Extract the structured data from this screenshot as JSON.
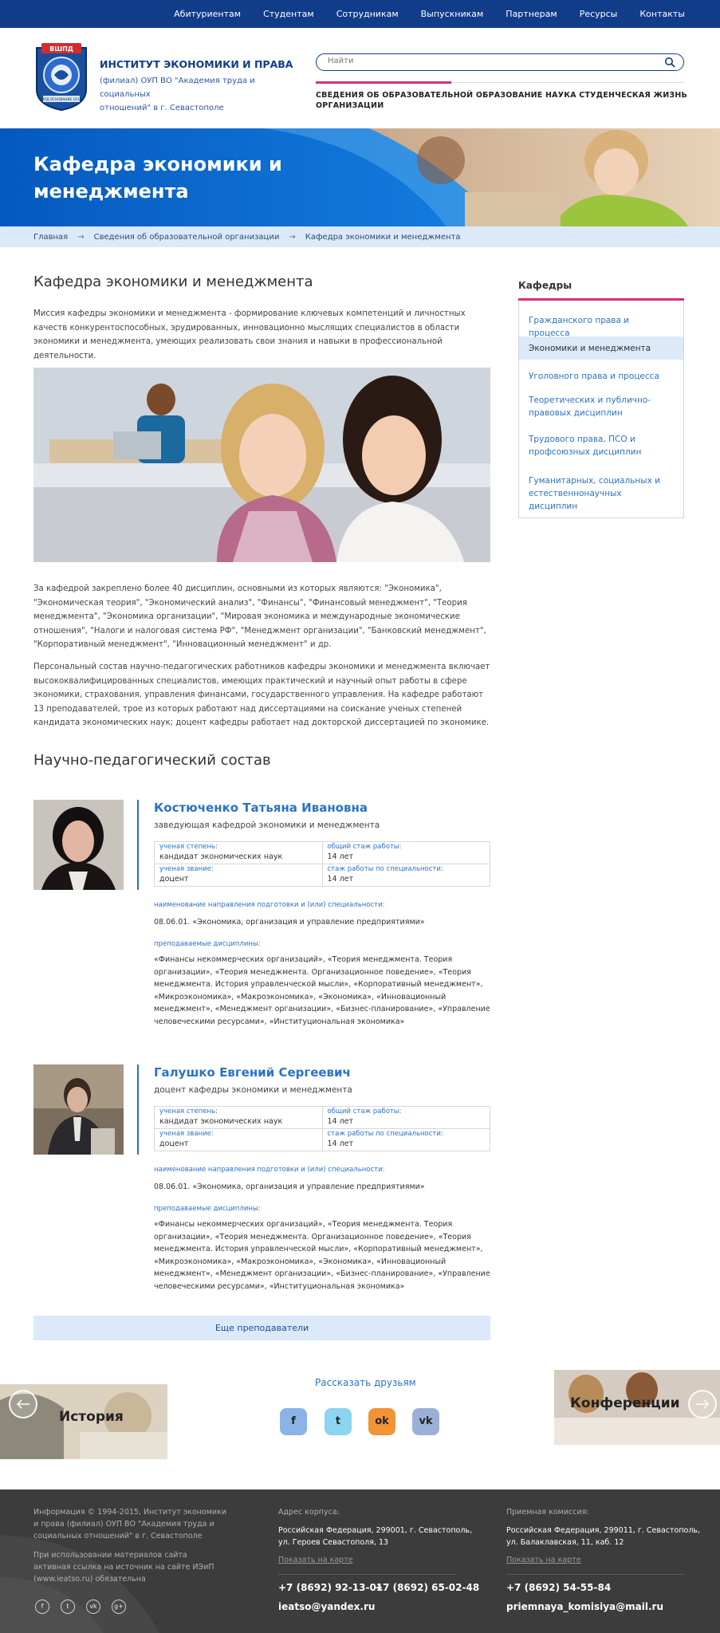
{
  "topnav": [
    "Абитуриентам",
    "Студентам",
    "Сотрудникам",
    "Выпускникам",
    "Партнерам",
    "Ресурсы",
    "Контакты"
  ],
  "header": {
    "title": "ИНСТИТУТ ЭКОНОМИКИ И ПРАВА",
    "subtitle1": "(филиал) ОУП ВО \"Академия труда и социальных",
    "subtitle2": "отношений\" в г. Севастополе",
    "logo_text1": "ВШПД",
    "logo_text2": "ПОД ОСНОВАНИЕ 1919"
  },
  "search": {
    "placeholder": "Найти"
  },
  "mainnav": [
    {
      "l1": "СВЕДЕНИЯ ОБ ОБРАЗОВАТЕЛЬНОЙ",
      "l2": "ОРГАНИЗАЦИИ"
    },
    {
      "l1": "ОБРАЗОВАНИЕ",
      "l2": ""
    },
    {
      "l1": "НАУКА",
      "l2": ""
    },
    {
      "l1": "СТУДЕНЧЕСКАЯ ЖИЗНЬ",
      "l2": ""
    }
  ],
  "hero": {
    "line1": "Кафедра экономики и",
    "line2": "менеджмента"
  },
  "breadcrumb": [
    "Главная",
    "Сведения об образовательной организации",
    "Кафедра экономики и менеджмента"
  ],
  "page": {
    "title": "Кафедра экономики и менеджмента",
    "mission": "Миссия кафедры экономики и менеджмента - формирование ключевых компетенций и личностных качеств конкурентоспособных, эрудированных, инновационно мыслящих специалистов в области экономики и менеджмента, умеющих реализовать свои знания и навыки в профессиональной деятельности.",
    "para2": "За кафедрой закреплено более 40 дисциплин, основными из которых являются: \"Экономика\", \"Экономическая теория\", \"Экономический анализ\", \"Финансы\", \"Финансовый менеджмент\", \"Теория менеджмента\", \"Экономика организации\", \"Мировая экономика и международные экономические отношения\", \"Налоги и налоговая система РФ\", \"Менеджмент организации\", \"Банковский менеджмент\", \"Корпоративный менеджмент\", \"Инновационный менеджмент\" и др.",
    "para3": "Персональный состав научно-педагогических работников кафедры экономики и менеджмента включает высококвалифицированных специалистов, имеющих практический и научный опыт работы в сфере экономики, страхования, управления финансами, государственного управления. На кафедре работают 13 преподавателей, трое из которых работают над диссертациями на соискание ученых степеней кандидата экономических наук; доцент кафедры работает над докторской диссертацией по экономике.",
    "staff_title": "Научно-педагогический состав"
  },
  "labels": {
    "degree": "ученая степень:",
    "total_exp": "общий стаж работы:",
    "rank": "ученая звание:",
    "spec_exp": "стаж работы по специальности:",
    "direction": "наименование направления подготовки и (или) специальности:",
    "disciplines": "преподаваемые дисциплины:"
  },
  "staff": [
    {
      "name": "Костюченко Татьяна Ивановна",
      "role": "заведующая кафедрой экономики и менеджмента",
      "degree": "кандидат экономических наук",
      "total_exp": "14 лет",
      "rank": "доцент",
      "spec_exp": "14 лет",
      "direction": "08.06.01. «Экономика, организация и управление предприятиями»",
      "disciplines": "«Финансы некоммерческих организаций», «Теория менеджмента. Теория организации», «Теория менеджмента. Организационное поведение», «Теория менеджмента. История управленческой мысли», «Корпоративный менеджмент», «Микроэкономика», «Макроэкономика», «Экономика», «Инновационный менеджмент», «Менеджмент организации», «Бизнес-планирование», «Управление человеческими ресурсами», «Институциональная экономика»"
    },
    {
      "name": "Галушко Евгений Сергеевич",
      "role": "доцент кафедры экономики и менеджмента",
      "degree": "кандидат экономических наук",
      "total_exp": "14 лет",
      "rank": "доцент",
      "spec_exp": "14 лет",
      "direction": "08.06.01. «Экономика, организация и управление предприятиями»",
      "disciplines": "«Финансы некоммерческих организаций», «Теория менеджмента. Теория организации», «Теория менеджмента. Организационное поведение», «Теория менеджмента. История управленческой мысли», «Корпоративный менеджмент», «Микроэкономика», «Макроэкономика», «Экономика», «Инновационный менеджмент», «Менеджмент организации», «Бизнес-планирование», «Управление человеческими ресурсами», «Институциональная экономика»"
    }
  ],
  "more_button": "Еще преподаватели",
  "sidebar": {
    "title": "Кафедры",
    "items": [
      "Гражданского права и процесса",
      "Экономики и менеджмента",
      "Уголовного права и процесса",
      "Теоретических и публично-правовых дисциплин",
      "Трудового права, ПСО и профсоюзных дисциплин",
      "Гуманитарных, социальных и естественнонаучных дисциплин"
    ]
  },
  "slider": {
    "left": "История",
    "right": "Конференции"
  },
  "share": {
    "title": "Рассказать друзьям",
    "icons": [
      {
        "name": "facebook-icon",
        "glyph": "f",
        "color": "#8ab3e8"
      },
      {
        "name": "twitter-icon",
        "glyph": "t",
        "color": "#8cd4f0"
      },
      {
        "name": "odnoklassniki-icon",
        "glyph": "ok",
        "color": "#f09435"
      },
      {
        "name": "vk-icon",
        "glyph": "vk",
        "color": "#9bb0d6"
      }
    ]
  },
  "footer": {
    "info": "Информация © 1994-2015, Институт экономики и права (филиал) ОУП ВО \"Академия труда и социальных отношений\" в г. Севастополе",
    "note": "При использовании материалов сайта активная ссылка на источник на сайте ИЭиП (www.ieatso.ru) обязательна",
    "addr_title": "Адрес корпуса:",
    "addr1": "Российская Федерация, 299001, г. Севастополь,",
    "addr2": "ул. Героев Севастополя, 13",
    "map": "Показать на карте",
    "phone1": "+7 (8692) 92-13-01",
    "phone2": "+7 (8692) 65-02-48",
    "email1": "ieatso@yandex.ru",
    "adm_title": "Приемная комиссия:",
    "adm1": "Российская Федерация, 299011, г. Севастополь,",
    "adm2": "ул. Балаклавская, 11, каб. 12",
    "map2": "Показать на карте",
    "phone3": "+7 (8692) 54-55-84",
    "email2": "priemnaya_komisiya@mail.ru",
    "social": [
      "f",
      "t",
      "vk",
      "g+"
    ]
  },
  "colors": {
    "brand": "#113c8a",
    "accent": "#d6307a",
    "link": "#2a72c7",
    "light": "#dce9f8"
  }
}
